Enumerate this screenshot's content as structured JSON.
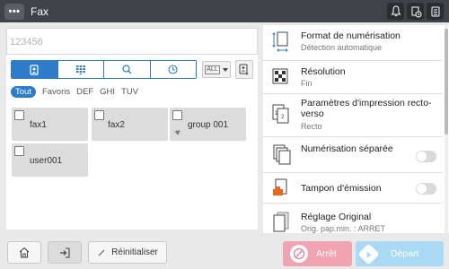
{
  "header": {
    "menu_label": "•••",
    "title": "Fax",
    "icons": [
      "bell-icon",
      "job-status-icon",
      "fax-status-icon"
    ]
  },
  "destination": {
    "value": "123456"
  },
  "search_bar": {
    "buttons": [
      "address-book-icon",
      "keypad-icon",
      "search-icon",
      "history-icon"
    ],
    "active_index": 0,
    "filter_dropdown": "ALL",
    "sort_icon": "sort-icon"
  },
  "filters": [
    "Tout",
    "Favoris",
    "DEF",
    "GHI",
    "TUV"
  ],
  "destinations": [
    {
      "label": "fax1"
    },
    {
      "label": "fax2"
    },
    {
      "label": "group  001",
      "group_icon": "☣"
    },
    {
      "label": "user001"
    }
  ],
  "settings": [
    {
      "title": "Format de numérisation",
      "sub": "Détection automatique",
      "icon": "scan-size-icon"
    },
    {
      "title": "Résolution",
      "sub": "Fin",
      "icon": "resolution-icon"
    },
    {
      "title": "Paramètres d'impression recto-verso",
      "sub": "Recto",
      "icon": "duplex-icon"
    },
    {
      "title": "Numérisation séparée",
      "icon": "separate-scan-icon",
      "toggle": false
    },
    {
      "title": "Tampon d'émission",
      "icon": "stamp-icon",
      "toggle": false
    },
    {
      "title": "Réglage Original",
      "sub": "Orig. pap.min. : ARRET",
      "icon": "original-setting-icon"
    }
  ],
  "bottom": {
    "reset_label": "Réinitialiser",
    "stop_label": "Arrêt",
    "start_label": "Départ"
  },
  "colors": {
    "accent": "#2d7cc9",
    "header": "#3f4249",
    "stop": "#f2a3b2",
    "start": "#a9d9f3",
    "stamp_orange": "#e8661e"
  }
}
